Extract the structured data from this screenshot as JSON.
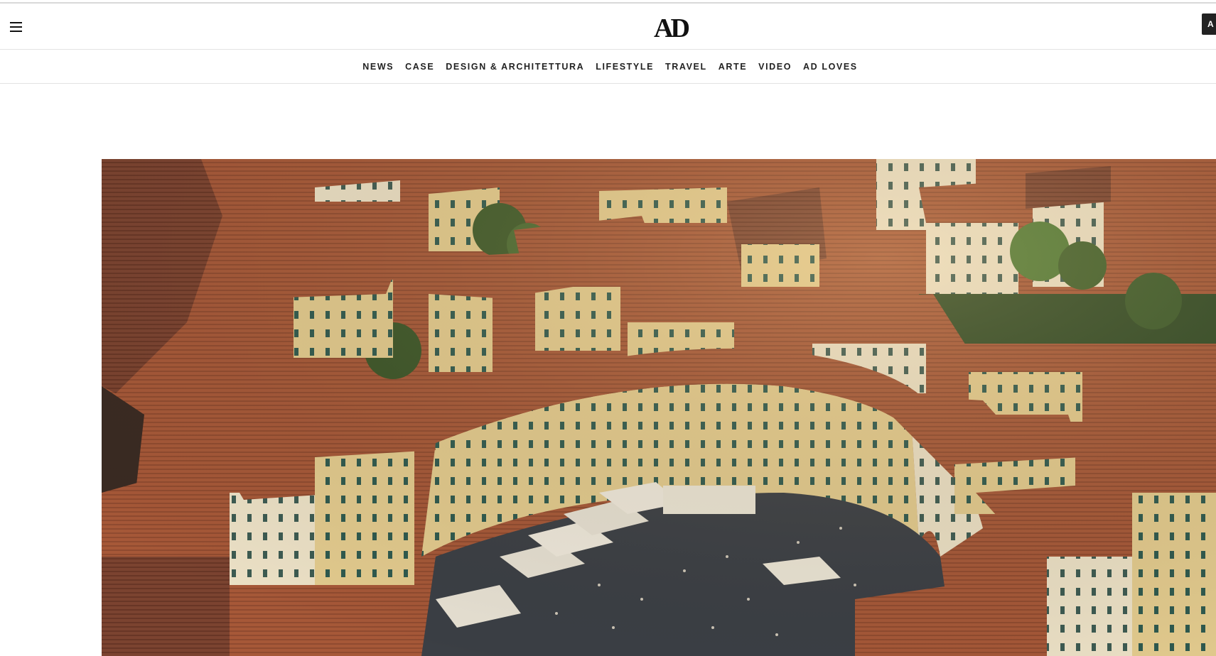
{
  "header": {
    "logo_text": "AD",
    "menu_icon": "hamburger-menu-icon",
    "account_label": "A"
  },
  "nav": {
    "items": [
      {
        "label": "NEWS"
      },
      {
        "label": "CASE"
      },
      {
        "label": "DESIGN & ARCHITETTURA"
      },
      {
        "label": "LIFESTYLE"
      },
      {
        "label": "TRAVEL"
      },
      {
        "label": "ARTE"
      },
      {
        "label": "VIDEO"
      },
      {
        "label": "AD LOVES"
      }
    ]
  },
  "hero": {
    "image_subject": "aerial-photo-piazza-anfiteatro",
    "colors": {
      "roof": "#a85a3a",
      "roof_dark": "#6e3a28",
      "facade": "#e2c98b",
      "piazza": "#3b3f45",
      "tree": "#3e5a2a"
    }
  }
}
